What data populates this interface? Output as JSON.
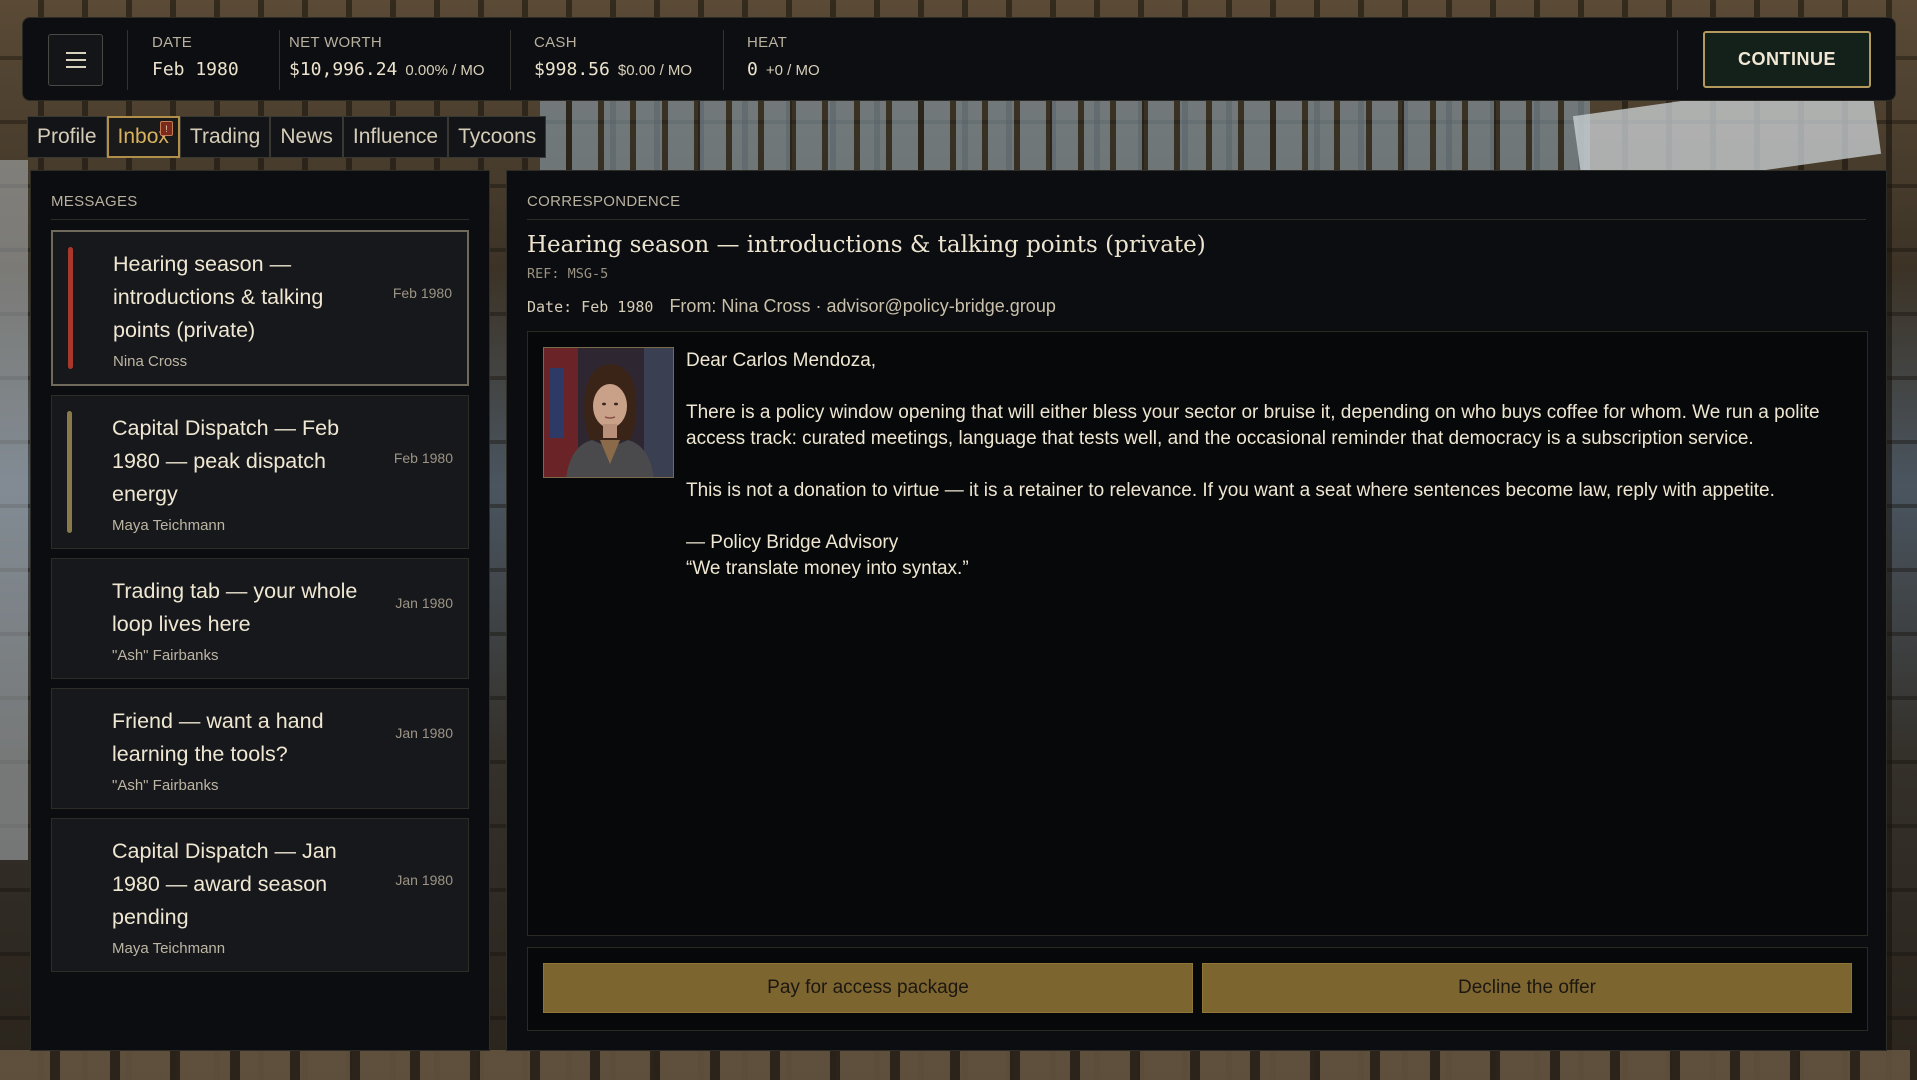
{
  "topbar": {
    "menu_icon": "hamburger-menu-icon",
    "date_label": "DATE",
    "date_value": "Feb 1980",
    "networth_label": "NET WORTH",
    "networth_value": "$10,996.24",
    "networth_rate": "0.00% / MO",
    "cash_label": "CASH",
    "cash_value": "$998.56",
    "cash_rate": "$0.00 / MO",
    "heat_label": "HEAT",
    "heat_value": "0",
    "heat_rate": "+0 / MO",
    "continue_label": "CONTINUE"
  },
  "tabs": [
    {
      "label": "Profile",
      "active": false
    },
    {
      "label": "Inbox",
      "active": true,
      "badge": "!"
    },
    {
      "label": "Trading",
      "active": false
    },
    {
      "label": "News",
      "active": false
    },
    {
      "label": "Influence",
      "active": false
    },
    {
      "label": "Tycoons",
      "active": false
    }
  ],
  "messages": {
    "heading": "MESSAGES",
    "items": [
      {
        "title": "Hearing season — introductions & talking points (private)",
        "sender": "Nina Cross",
        "date": "Feb 1980",
        "stripe_color": "#a8382c",
        "selected": true
      },
      {
        "title": "Capital Dispatch — Feb 1980 — peak dispatch energy",
        "sender": "Maya Teichmann",
        "date": "Feb 1980",
        "stripe_color": "#8a7a4a",
        "selected": false
      },
      {
        "title": "Trading tab — your whole loop lives here",
        "sender": "\"Ash\" Fairbanks",
        "date": "Jan 1980",
        "stripe_color": "",
        "selected": false
      },
      {
        "title": "Friend — want a hand learning the tools?",
        "sender": "\"Ash\" Fairbanks",
        "date": "Jan 1980",
        "stripe_color": "",
        "selected": false
      },
      {
        "title": "Capital Dispatch — Jan 1980 — award season pending",
        "sender": "Maya Teichmann",
        "date": "Jan 1980",
        "stripe_color": "",
        "selected": false
      }
    ]
  },
  "correspondence": {
    "heading": "CORRESPONDENCE",
    "subject": "Hearing season — introductions & talking points (private)",
    "ref": "REF: MSG-5",
    "date": "Date: Feb 1980",
    "from": "From: Nina Cross · advisor@policy-bridge.group",
    "salutation": "Dear Carlos Mendoza,",
    "paragraph1": "There is a policy window opening that will either bless your sector or bruise it, depending on who buys coffee for whom. We run a polite access track: curated meetings, language that tests well, and the occasional reminder that democracy is a subscription service.",
    "paragraph2": "This is not a donation to virtue — it is a retainer to relevance. If you want a seat where sentences become law, reply with appetite.",
    "signature": "— Policy Bridge Advisory",
    "tagline": "“We translate money into syntax.”"
  },
  "actions": {
    "pay_label": "Pay for access package",
    "decline_label": "Decline the offer"
  },
  "colors": {
    "accent_gold": "#b39a5c",
    "button_gold": "#7d6530",
    "panel_bg": "#0c0d10"
  }
}
